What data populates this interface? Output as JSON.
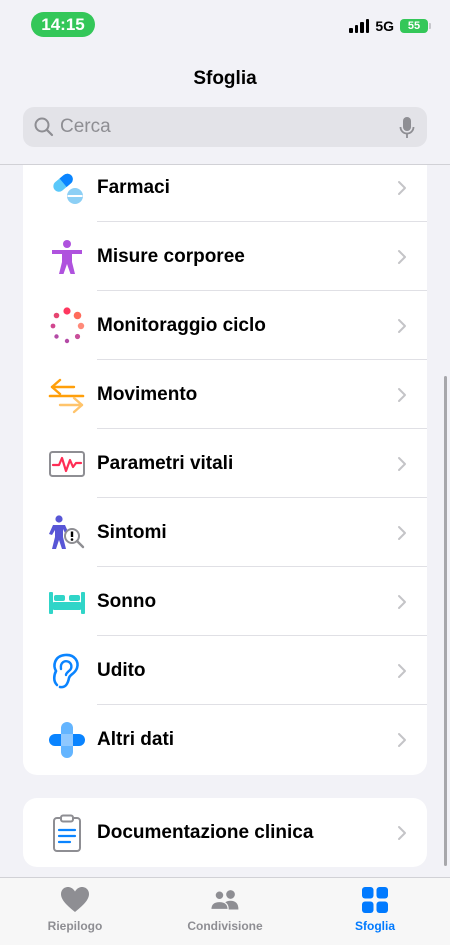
{
  "status_bar": {
    "time": "14:15",
    "network": "5G",
    "battery": "55"
  },
  "header": {
    "title": "Sfoglia"
  },
  "search": {
    "placeholder": "Cerca"
  },
  "categories": [
    {
      "label": "Farmaci",
      "icon": "pills-icon"
    },
    {
      "label": "Misure corporee",
      "icon": "body-figure-icon"
    },
    {
      "label": "Monitoraggio ciclo",
      "icon": "cycle-dots-icon"
    },
    {
      "label": "Movimento",
      "icon": "arrows-icon"
    },
    {
      "label": "Parametri vitali",
      "icon": "vitals-monitor-icon"
    },
    {
      "label": "Sintomi",
      "icon": "symptoms-icon"
    },
    {
      "label": "Sonno",
      "icon": "bed-icon"
    },
    {
      "label": "Udito",
      "icon": "ear-icon"
    },
    {
      "label": "Altri dati",
      "icon": "plus-icon"
    }
  ],
  "clinical": {
    "label": "Documentazione clinica",
    "icon": "clipboard-icon"
  },
  "tabs": [
    {
      "label": "Riepilogo",
      "icon": "heart-icon",
      "active": false
    },
    {
      "label": "Condivisione",
      "icon": "people-icon",
      "active": false
    },
    {
      "label": "Sfoglia",
      "icon": "grid-icon",
      "active": true
    }
  ],
  "colors": {
    "accent": "#007aff",
    "time_pill": "#34c759",
    "battery": "#34c759",
    "inactive_tab": "#8e8e93"
  }
}
